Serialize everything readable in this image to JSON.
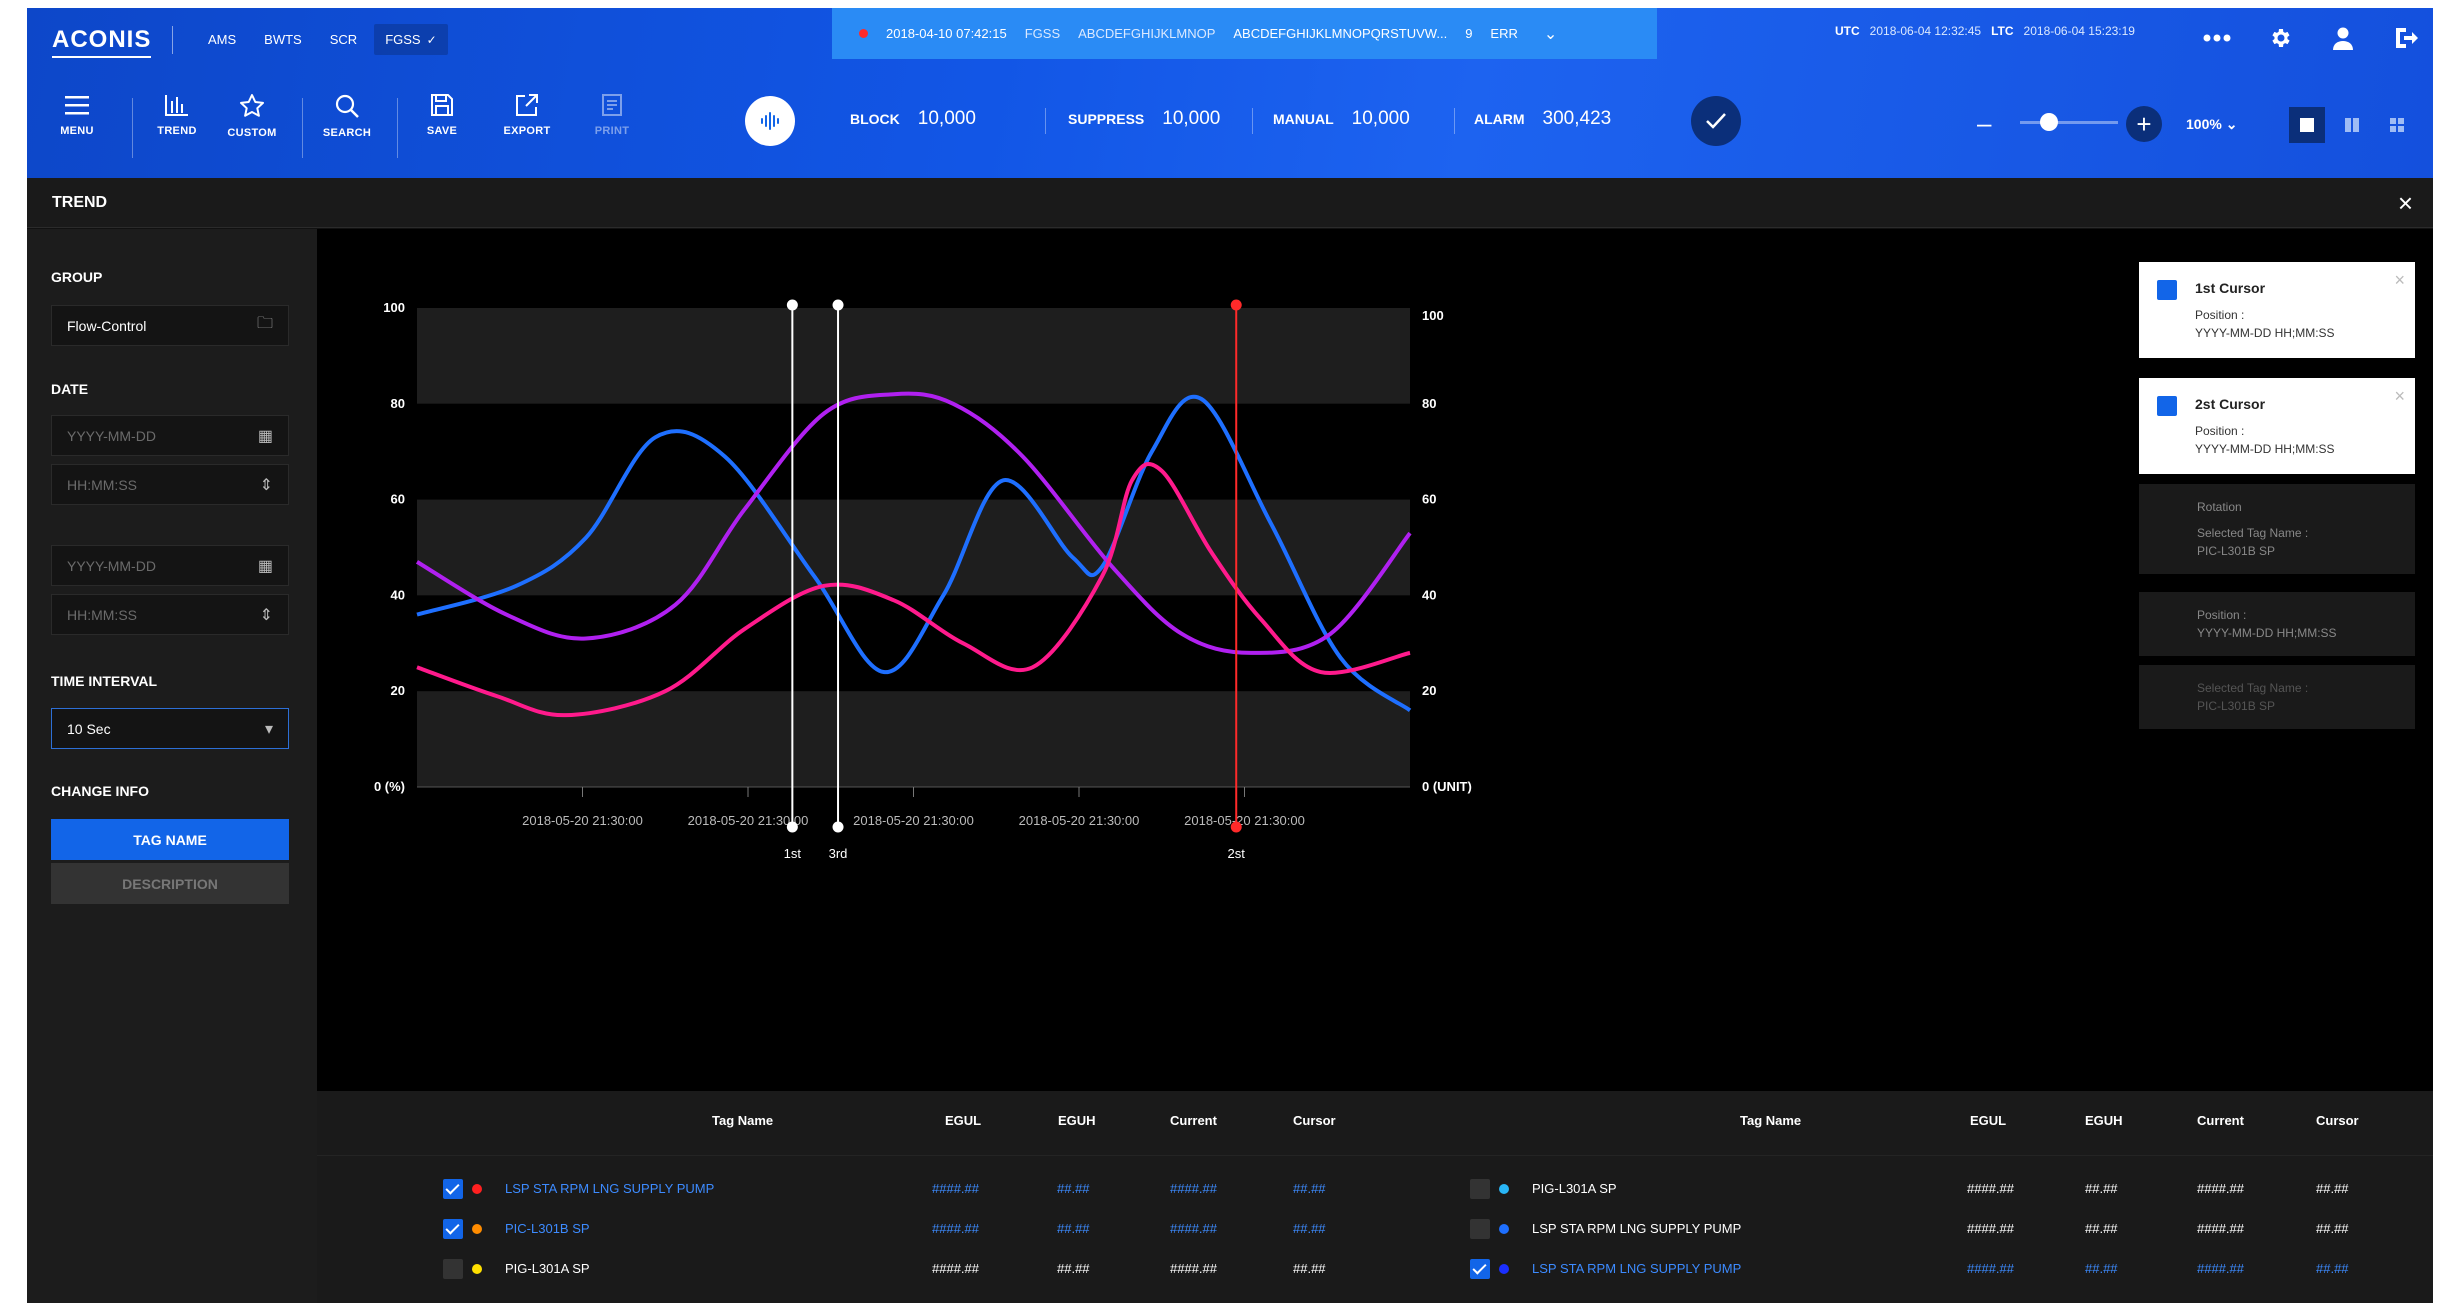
{
  "app": {
    "logo": "ACONIS"
  },
  "system_tabs": [
    {
      "label": "AMS",
      "active": false
    },
    {
      "label": "BWTS",
      "active": false
    },
    {
      "label": "SCR",
      "active": false
    },
    {
      "label": "FGSS",
      "active": true
    }
  ],
  "alarm_banner": {
    "timestamp": "2018-04-10 07:42:15",
    "system": "FGSS",
    "tag": "ABCDEFGHIJKLMNOP",
    "message": "ABCDEFGHIJKLMNOPQRSTUVW...",
    "count": "9",
    "status": "ERR",
    "dot_color": "#ff2a2a"
  },
  "clock": {
    "utc_label": "UTC",
    "utc_value": "2018-06-04 12:32:45",
    "ltc_label": "LTC",
    "ltc_value": "2018-06-04 15:23:19"
  },
  "top_icons": [
    "more-icon",
    "gear-icon",
    "user-icon",
    "logout-icon"
  ],
  "toolbar": {
    "menu": "MENU",
    "trend": "TREND",
    "custom": "CUSTOM",
    "search": "SEARCH",
    "save": "SAVE",
    "export": "EXPORT",
    "print": "PRINT"
  },
  "counters": {
    "block_label": "BLOCK",
    "block_value": "10,000",
    "suppress_label": "SUPPRESS",
    "suppress_value": "10,000",
    "manual_label": "MANUAL",
    "manual_value": "10,000",
    "alarm_label": "ALARM",
    "alarm_value": "300,423"
  },
  "zoom": {
    "level": "100%",
    "slider_fraction": 0.3
  },
  "panel_title": "TREND",
  "left_panel": {
    "group_label": "GROUP",
    "group_value": "Flow-Control",
    "date_label": "DATE",
    "date_from_placeholder": "YYYY-MM-DD",
    "time_from_placeholder": "HH:MM:SS",
    "date_to_placeholder": "YYYY-MM-DD",
    "time_to_placeholder": "HH:MM:SS",
    "interval_label": "TIME INTERVAL",
    "interval_value": "10 Sec",
    "change_info_label": "CHANGE INFO",
    "tag_name_btn": "TAG NAME",
    "description_btn": "DESCRIPTION"
  },
  "chart_data": {
    "type": "line",
    "ylim": [
      0,
      100
    ],
    "left_axis_ticks": [
      "100",
      "80",
      "60",
      "40",
      "20",
      "0 (%)"
    ],
    "right_axis_ticks": [
      "100",
      "80",
      "60",
      "40",
      "20",
      "0 (UNIT)"
    ],
    "x_tick_labels": [
      "2018-05-20 21:30:00",
      "2018-05-20 21:30:00",
      "2018-05-20 21:30:00",
      "2018-05-20 21:30:00",
      "2018-05-20 21:30:00"
    ],
    "x_domain": [
      0,
      100
    ],
    "series": [
      {
        "color": "#1e6fff",
        "points": [
          [
            0,
            36
          ],
          [
            10,
            42
          ],
          [
            17,
            52
          ],
          [
            24,
            73
          ],
          [
            31,
            69
          ],
          [
            40,
            44
          ],
          [
            47,
            24
          ],
          [
            53,
            40
          ],
          [
            59,
            64
          ],
          [
            66,
            48
          ],
          [
            69,
            46
          ],
          [
            74,
            70
          ],
          [
            79,
            81
          ],
          [
            86,
            55
          ],
          [
            93,
            27
          ],
          [
            100,
            16
          ]
        ]
      },
      {
        "color": "#b020f0",
        "points": [
          [
            0,
            47
          ],
          [
            9,
            36
          ],
          [
            17,
            31
          ],
          [
            26,
            38
          ],
          [
            33,
            58
          ],
          [
            41,
            78
          ],
          [
            48,
            82
          ],
          [
            54,
            80
          ],
          [
            61,
            69
          ],
          [
            70,
            46
          ],
          [
            77,
            32
          ],
          [
            84,
            28
          ],
          [
            92,
            32
          ],
          [
            100,
            53
          ]
        ]
      },
      {
        "color": "#ff1a8c",
        "points": [
          [
            0,
            25
          ],
          [
            8,
            19
          ],
          [
            15,
            15
          ],
          [
            25,
            20
          ],
          [
            33,
            33
          ],
          [
            41,
            42
          ],
          [
            48,
            39
          ],
          [
            55,
            30
          ],
          [
            62,
            25
          ],
          [
            69,
            44
          ],
          [
            72,
            64
          ],
          [
            75,
            66
          ],
          [
            80,
            49
          ],
          [
            85,
            35
          ],
          [
            91,
            24
          ],
          [
            100,
            28
          ]
        ]
      }
    ],
    "cursors": [
      {
        "label": "1st",
        "x": 37.8,
        "color": "#ffffff"
      },
      {
        "label": "3rd",
        "x": 42.4,
        "color": "#ffffff"
      },
      {
        "label": "2st",
        "x": 82.5,
        "color": "#ff2a2a"
      }
    ]
  },
  "cursor_panels": [
    {
      "title": "1st Cursor",
      "position_label": "Position :",
      "position_value": "YYYY-MM-DD HH;MM:SS"
    },
    {
      "title": "2st Cursor",
      "position_label": "Position :",
      "position_value": "YYYY-MM-DD HH;MM:SS"
    }
  ],
  "cursor_ghosts": [
    {
      "line1": "Rotation",
      "line2": "Selected Tag Name :",
      "line3": "PIC-L301B SP"
    },
    {
      "line1": "Position :",
      "line2": "YYYY-MM-DD HH;MM:SS"
    },
    {
      "line1": "Selected Tag Name :",
      "line2": "PIC-L301B SP"
    }
  ],
  "table": {
    "headers": {
      "tag": "Tag Name",
      "egul": "EGUL",
      "eguh": "EGUH",
      "current": "Current",
      "cursor": "Cursor"
    },
    "left_rows": [
      {
        "checked": true,
        "dot": "#ff2020",
        "tag": "LSP STA RPM LNG SUPPLY PUMP",
        "egul": "####.##",
        "eguh": "##.##",
        "current": "####.##",
        "cursor": "##.##"
      },
      {
        "checked": true,
        "dot": "#ff8c00",
        "tag": "PIC-L301B SP",
        "egul": "####.##",
        "eguh": "##.##",
        "current": "####.##",
        "cursor": "##.##"
      },
      {
        "checked": false,
        "dot": "#ffe000",
        "tag": "PIG-L301A SP",
        "egul": "####.##",
        "eguh": "##.##",
        "current": "####.##",
        "cursor": "##.##"
      }
    ],
    "right_rows": [
      {
        "checked": false,
        "dot": "#29b6f6",
        "tag": "PIG-L301A SP",
        "egul": "####.##",
        "eguh": "##.##",
        "current": "####.##",
        "cursor": "##.##"
      },
      {
        "checked": false,
        "dot": "#1e6fff",
        "tag": "LSP STA RPM LNG SUPPLY PUMP",
        "egul": "####.##",
        "eguh": "##.##",
        "current": "####.##",
        "cursor": "##.##"
      },
      {
        "checked": true,
        "dot": "#1a2fff",
        "tag": "LSP STA RPM LNG SUPPLY PUMP",
        "egul": "####.##",
        "eguh": "##.##",
        "current": "####.##",
        "cursor": "##.##"
      }
    ]
  }
}
